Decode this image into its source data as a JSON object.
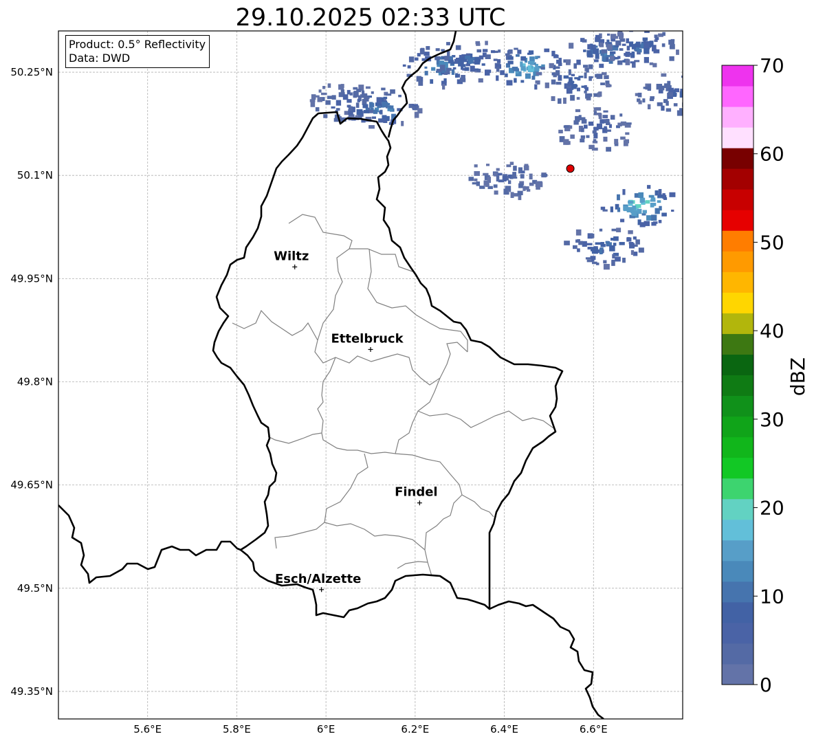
{
  "title": "29.10.2025 02:33 UTC",
  "info": {
    "product": "Product: 0.5° Reflectivity",
    "source": "Data: DWD"
  },
  "extent": {
    "lon": [
      5.4,
      6.8
    ],
    "lat": [
      49.31,
      50.31
    ]
  },
  "lat_ticks": [
    {
      "value": 50.25,
      "label": "50.25°N"
    },
    {
      "value": 50.1,
      "label": "50.1°N"
    },
    {
      "value": 49.95,
      "label": "49.95°N"
    },
    {
      "value": 49.8,
      "label": "49.8°N"
    },
    {
      "value": 49.65,
      "label": "49.65°N"
    },
    {
      "value": 49.5,
      "label": "49.5°N"
    },
    {
      "value": 49.35,
      "label": "49.35°N"
    }
  ],
  "lon_ticks": [
    {
      "value": 5.6,
      "label": "5.6°E"
    },
    {
      "value": 5.8,
      "label": "5.8°E"
    },
    {
      "value": 6.0,
      "label": "6°E"
    },
    {
      "value": 6.2,
      "label": "6.2°E"
    },
    {
      "value": 6.4,
      "label": "6.4°E"
    },
    {
      "value": 6.6,
      "label": "6.6°E"
    }
  ],
  "cities": [
    {
      "name": "Wiltz",
      "lon": 5.93,
      "lat": 49.967
    },
    {
      "name": "Ettelbruck",
      "lon": 6.1,
      "lat": 49.847
    },
    {
      "name": "Findel",
      "lon": 6.21,
      "lat": 49.624
    },
    {
      "name": "Esch/Alzette",
      "lon": 5.99,
      "lat": 49.498
    }
  ],
  "radar_site": {
    "lon": 6.548,
    "lat": 50.11,
    "color": "#e00000"
  },
  "colorbar": {
    "label": "dBZ",
    "min": 0,
    "max": 70,
    "ticks": [
      0,
      10,
      20,
      30,
      40,
      50,
      60,
      70
    ],
    "colors": [
      "#6373a8",
      "#546aa5",
      "#4a63a6",
      "#4262a5",
      "#4674ae",
      "#4a89ba",
      "#579ec8",
      "#62bfd9",
      "#62d2c2",
      "#3dd46f",
      "#12c825",
      "#11b61b",
      "#10a419",
      "#10911a",
      "#0f7b14",
      "#0a6611",
      "#3d7812",
      "#b2b60c",
      "#ffd600",
      "#ffb600",
      "#ff9a00",
      "#ff7d00",
      "#e60000",
      "#c80000",
      "#a30000",
      "#780000",
      "#ffe0ff",
      "#ffb0ff",
      "#ff66ff",
      "#ee33ee"
    ]
  },
  "reflectivity_cells": [
    {
      "lon": 6.05,
      "lat": 50.21,
      "dbz": 6
    },
    {
      "lon": 6.12,
      "lat": 50.2,
      "dbz": 12
    },
    {
      "lon": 6.25,
      "lat": 50.26,
      "dbz": 14
    },
    {
      "lon": 6.32,
      "lat": 50.27,
      "dbz": 10
    },
    {
      "lon": 6.45,
      "lat": 50.26,
      "dbz": 17
    },
    {
      "lon": 6.55,
      "lat": 50.24,
      "dbz": 8
    },
    {
      "lon": 6.62,
      "lat": 50.28,
      "dbz": 12
    },
    {
      "lon": 6.7,
      "lat": 50.29,
      "dbz": 9
    },
    {
      "lon": 6.78,
      "lat": 50.22,
      "dbz": 7
    },
    {
      "lon": 6.6,
      "lat": 50.17,
      "dbz": 6
    },
    {
      "lon": 6.7,
      "lat": 50.06,
      "dbz": 21
    },
    {
      "lon": 6.62,
      "lat": 50.0,
      "dbz": 10
    },
    {
      "lon": 6.4,
      "lat": 50.1,
      "dbz": 5
    }
  ]
}
